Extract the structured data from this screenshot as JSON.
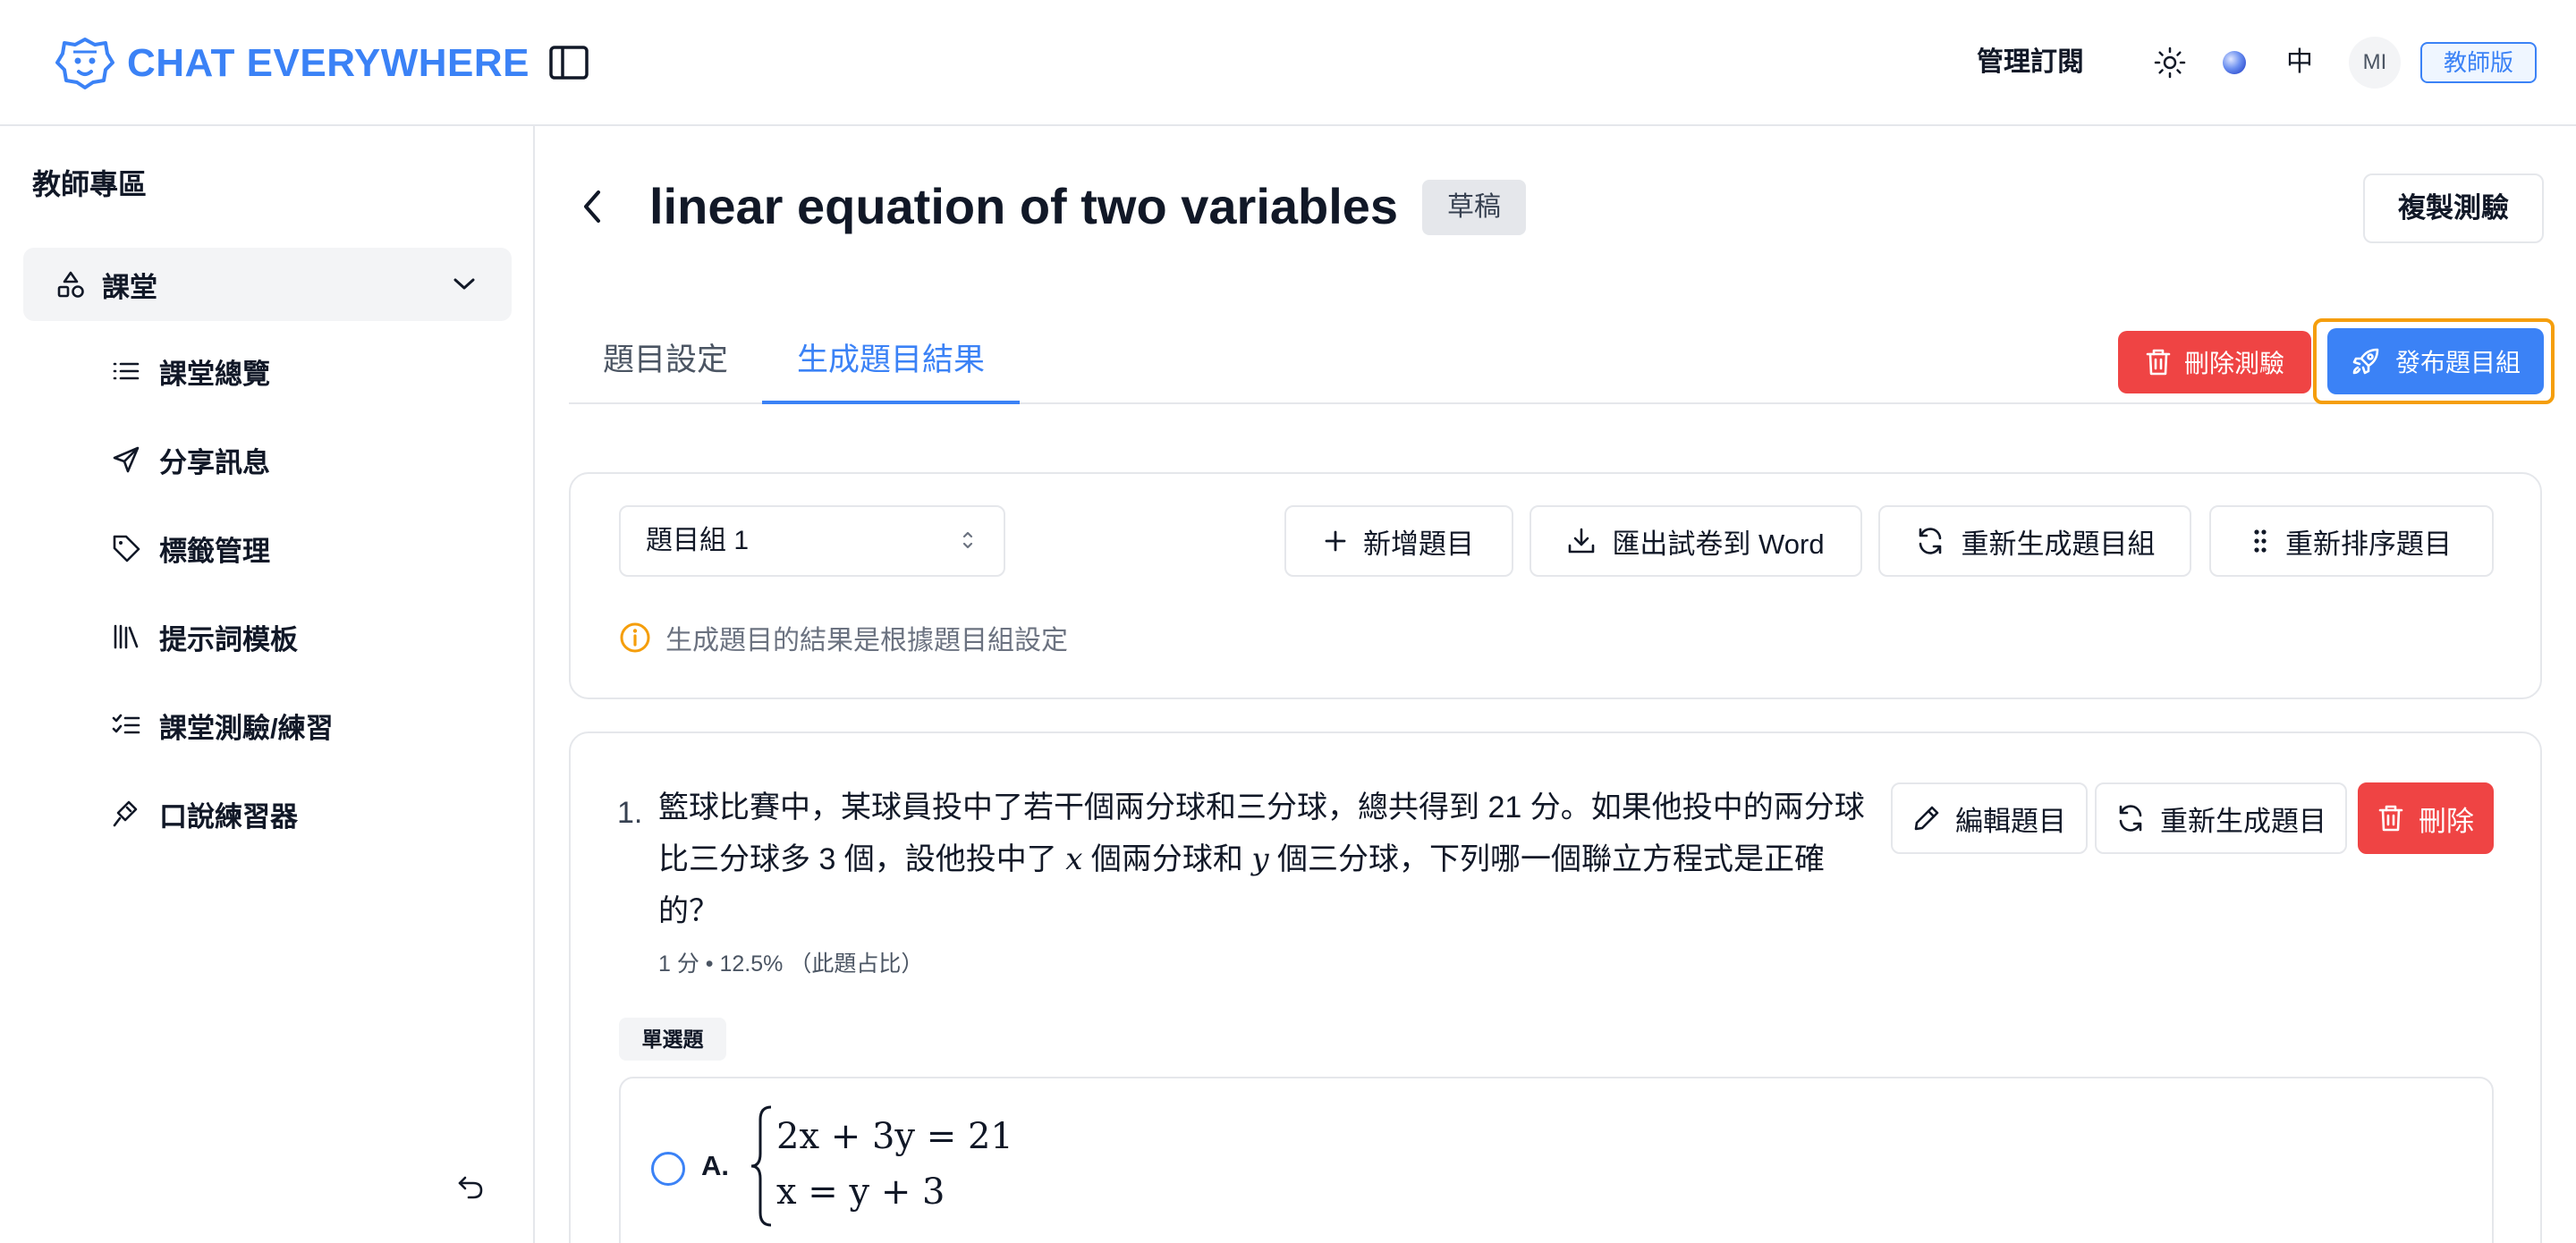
{
  "header": {
    "brand": "CHAT EVERYWHERE",
    "manage_subscription": "管理訂閱",
    "language": "中",
    "avatar_initials": "MI",
    "edition_badge": "教師版"
  },
  "sidebar": {
    "title": "教師專區",
    "parent_item": {
      "label": "課堂",
      "icon": "shapes-icon",
      "expanded": true
    },
    "items": [
      {
        "label": "課堂總覽",
        "icon": "list-icon"
      },
      {
        "label": "分享訊息",
        "icon": "send-icon"
      },
      {
        "label": "標籤管理",
        "icon": "tag-icon"
      },
      {
        "label": "提示詞模板",
        "icon": "library-icon"
      },
      {
        "label": "課堂測驗/練習",
        "icon": "checklist-icon"
      },
      {
        "label": "口說練習器",
        "icon": "mic-icon"
      }
    ]
  },
  "page": {
    "title": "linear equation of two variables",
    "status_badge": "草稿",
    "copy_button": "複製測驗",
    "tabs": [
      {
        "label": "題目設定",
        "active": false
      },
      {
        "label": "生成題目結果",
        "active": true
      }
    ],
    "delete_quiz_button": "刪除測驗",
    "publish_button": "發布題目組"
  },
  "toolbar": {
    "group_select_value": "題目組 1",
    "add_question": "新增題目",
    "export_word": "匯出試卷到 Word",
    "regenerate_group": "重新生成題目組",
    "reorder": "重新排序題目",
    "info_text": "生成題目的結果是根據題目組設定"
  },
  "question": {
    "number": "1.",
    "text_part1": "籃球比賽中，某球員投中了若干個兩分球和三分球，總共得到 21 分。如果他投中的兩分球比三分球多 3 個，設他投中了 ",
    "var_x": "x",
    "text_part2": " 個兩分球和 ",
    "var_y": "y",
    "text_part3": " 個三分球，下列哪一個聯立方程式是正確的？",
    "meta": "1 分 • 12.5% （此題占比）",
    "edit_button": "編輯題目",
    "regenerate_button": "重新生成題目",
    "delete_button": "刪除",
    "type_tag": "單選題",
    "options": [
      {
        "label": "A.",
        "equation_1": "2x + 3y = 21",
        "equation_2": "x = y + 3"
      }
    ]
  },
  "colors": {
    "primary": "#3b82f6",
    "danger": "#ef4444",
    "highlight_border": "#f59e0b",
    "info_icon": "#f59e0b"
  }
}
